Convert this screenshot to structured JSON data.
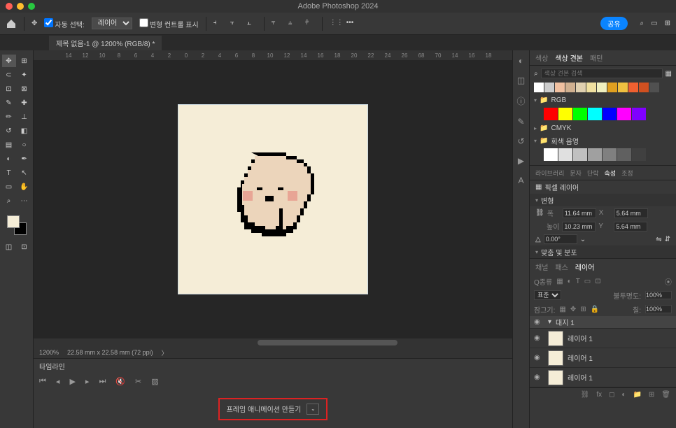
{
  "app": {
    "title": "Adobe Photoshop 2024"
  },
  "optbar": {
    "auto_select_label": "자동 선택:",
    "auto_select_value": "레이어",
    "transform_controls_label": "변형 컨트롤 표시",
    "share_label": "공유"
  },
  "doc": {
    "tab_title": "제목 없음-1 @ 1200% (RGB/8) *"
  },
  "rulers": {
    "marks": [
      "",
      "14",
      "12",
      "10",
      "8",
      "6",
      "4",
      "2",
      "0",
      "2",
      "4",
      "6",
      "8",
      "10",
      "12",
      "14",
      "16",
      "18",
      "20",
      "22",
      "24",
      "26",
      "68",
      "70",
      "14",
      "16",
      "18"
    ]
  },
  "canvas": {
    "artboard_label": "대지 1"
  },
  "status": {
    "zoom": "1200%",
    "dims": "22.58 mm x 22.58 mm (72 ppi)",
    "arrow": "〉"
  },
  "timeline": {
    "title": "타임라인",
    "dropdown": "프레임 애니메이션 만들기"
  },
  "right": {
    "tabs": [
      "색상",
      "색상 견본",
      "패턴"
    ],
    "search_placeholder": "색상 견본 검색",
    "rgb": "RGB",
    "cmyk": "CMYK",
    "shade": "회색 음영",
    "tabs2": [
      "라이브러리",
      "문자",
      "단락",
      "속성",
      "조정"
    ],
    "props": {
      "layer_type": "픽셀 레이어",
      "transform_h": "변형",
      "w_label": "폭",
      "w_val": "11.64 mm",
      "x_label": "X",
      "x_val": "5.64 mm",
      "h_label": "높이",
      "h_val": "10.23 mm",
      "y_label": "Y",
      "y_val": "5.64 mm",
      "angle": "0.00°",
      "align_h": "맞춤 및 분포"
    }
  },
  "layers": {
    "tabs": [
      "채널",
      "패스",
      "레이어"
    ],
    "kind_label": "Q종류",
    "blend": "표준",
    "opacity_label": "불투명도:",
    "opacity": "100%",
    "lock_label": "잠그기:",
    "fill_label": "칠:",
    "fill": "100%",
    "artboard": "대지 1",
    "items": [
      "레이어 1",
      "레이어 1",
      "레이어 1"
    ]
  },
  "swatches_neutral": [
    "#fff",
    "#ccc",
    "#f0c0a0",
    "#d0b090",
    "#e0d0b0",
    "#f0e0a0",
    "#f0f0c0",
    "#e0a020",
    "#f0c040",
    "#f06030",
    "#d05020",
    "#505050"
  ],
  "swatches_rgb": [
    "#ff0000",
    "#ffff00",
    "#00ff00",
    "#00ffff",
    "#0000ff",
    "#ff00ff",
    "#8000ff"
  ],
  "shades": [
    "#fff",
    "#e0e0e0",
    "#c0c0c0",
    "#a0a0a0",
    "#808080",
    "#606060",
    "#404040"
  ]
}
